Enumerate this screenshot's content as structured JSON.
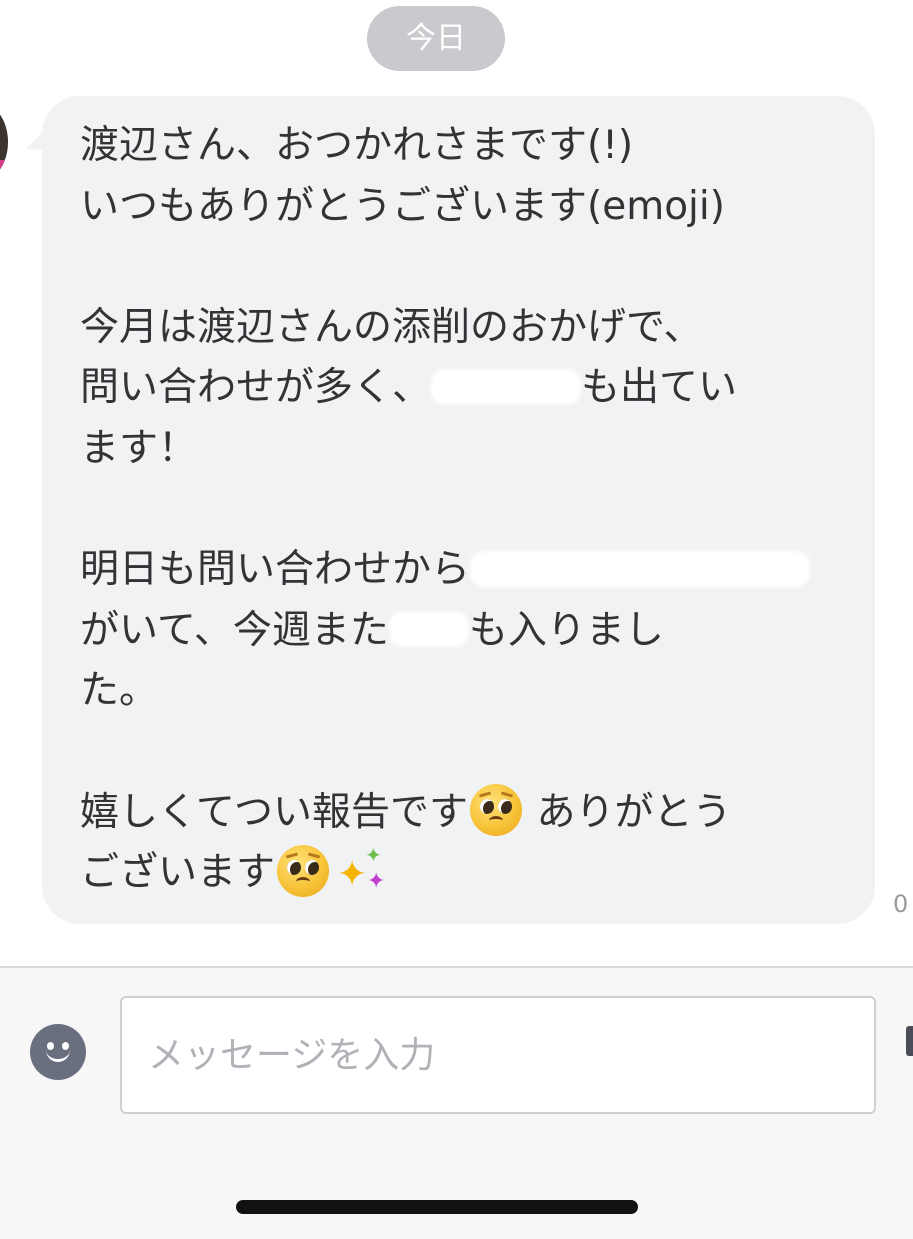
{
  "chat": {
    "date_label": "今日",
    "timestamp_partial": "0",
    "message": {
      "line1": "渡辺さん、おつかれさまです(!)",
      "line2": "いつもありがとうございます(emoji)",
      "line3": "今月は渡辺さんの添削のおかげで、",
      "line4a": "問い合わせが多く、",
      "line4b": "も出てい",
      "line5": "ます！",
      "line6": "明日も問い合わせから",
      "line7a": "がいて、今週また",
      "line7b": "も入りまし",
      "line8": "た。",
      "line9a": "嬉しくてつい報告です",
      "line9b": "ありがとう",
      "line10": "ございます"
    },
    "emoji_icons": [
      "pleading-face-icon",
      "sparkles-icon"
    ]
  },
  "composer": {
    "placeholder": "メッセージを入力",
    "emoji_button_icon": "smiley-icon"
  }
}
